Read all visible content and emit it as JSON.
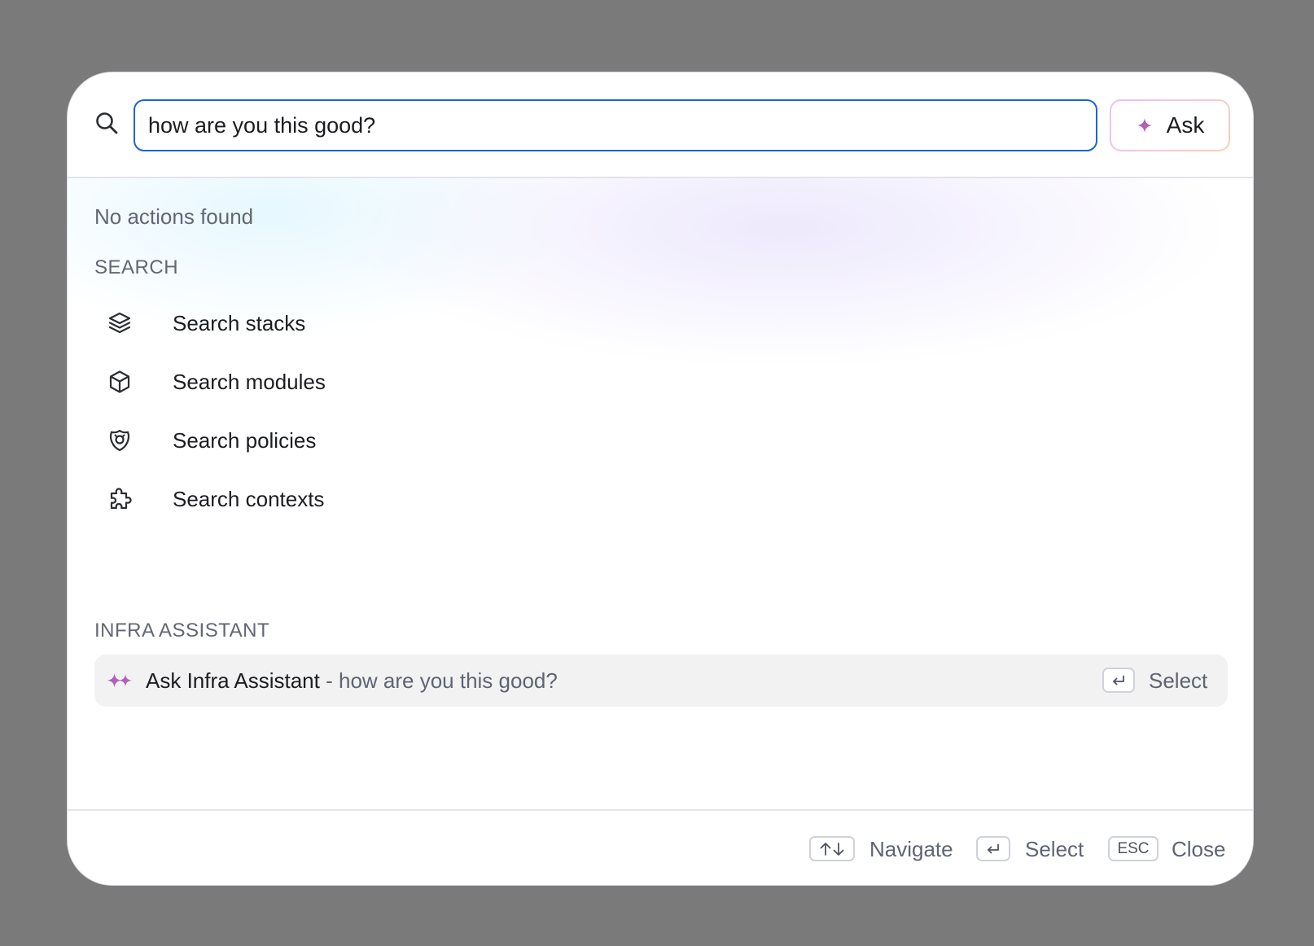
{
  "colors": {
    "backdrop": "#7a7a7a",
    "input_focus": "#1d63d8",
    "assistant_icon_start": "#8e63d6",
    "assistant_icon_end": "#d95aa2",
    "ask_border_start": "#e7c2f6",
    "ask_border_end": "#f8d2b0",
    "selected_row": "#f2f2f3"
  },
  "search": {
    "icon": "search-icon",
    "value": "how are you this good?",
    "placeholder": ""
  },
  "ask_button": {
    "icon": "sparkle-icon",
    "label": "Ask"
  },
  "results": {
    "empty_message": "No actions found",
    "sections": [
      {
        "heading": "SEARCH",
        "items": [
          {
            "icon": "stack-layers-icon",
            "label": "Search stacks"
          },
          {
            "icon": "cube-icon",
            "label": "Search modules"
          },
          {
            "icon": "policy-badge-icon",
            "label": "Search policies"
          },
          {
            "icon": "puzzle-icon",
            "label": "Search contexts"
          }
        ]
      },
      {
        "heading": "INFRA ASSISTANT",
        "items": [
          {
            "icon": "sparkles-icon",
            "label": "Ask Infra Assistant",
            "query": " - how are you this good?",
            "hint_key_icon": "enter-icon",
            "hint_label": "Select",
            "selected": true
          }
        ]
      }
    ]
  },
  "footer": {
    "hints": [
      {
        "key_icon": "arrow-up-down-icon",
        "label": "Navigate"
      },
      {
        "key_icon": "enter-icon",
        "label": "Select"
      },
      {
        "key": "ESC",
        "label": "Close"
      }
    ]
  }
}
